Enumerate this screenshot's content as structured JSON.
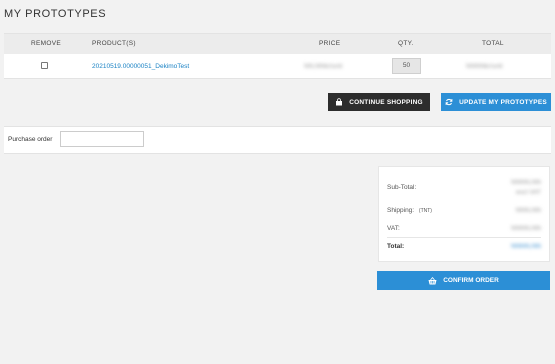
{
  "page": {
    "title": "MY PROTOTYPES"
  },
  "table": {
    "headers": {
      "remove": "REMOVE",
      "product": "PRODUCT(S)",
      "price": "PRICE",
      "qty": "QTY.",
      "total": "TOTAL"
    },
    "rows": [
      {
        "product": "20210519.00000051_DekimoTest",
        "price": "NN,NNkr/unit",
        "qty": "50",
        "total": "NNNNkr/unit"
      }
    ]
  },
  "actions": {
    "continue_shopping": "CONTINUE SHOPPING",
    "update_prototypes": "UPDATE MY PROTOTYPES"
  },
  "purchase_order": {
    "label": "Purchase order",
    "value": ""
  },
  "summary": {
    "subtotal_label": "Sub-Total:",
    "subtotal_value_1": "NNNN,NN",
    "subtotal_value_2": "excl VAT",
    "shipping_label": "Shipping:",
    "shipping_carrier": "(TNT)",
    "shipping_value": "NNN,NN",
    "vat_label": "VAT:",
    "vat_value": "NNNN,NN",
    "total_label": "Total:",
    "total_value": "NNNN,NN"
  },
  "confirm": {
    "label": "CONFIRM ORDER"
  },
  "colors": {
    "accent": "#2c8fd6",
    "dark_button": "#2d2d2d",
    "link": "#1a82c4",
    "background": "#f2f2f2"
  },
  "icons": {
    "continue": "shopping-bag-icon",
    "update": "refresh-icon",
    "confirm": "basket-icon"
  }
}
